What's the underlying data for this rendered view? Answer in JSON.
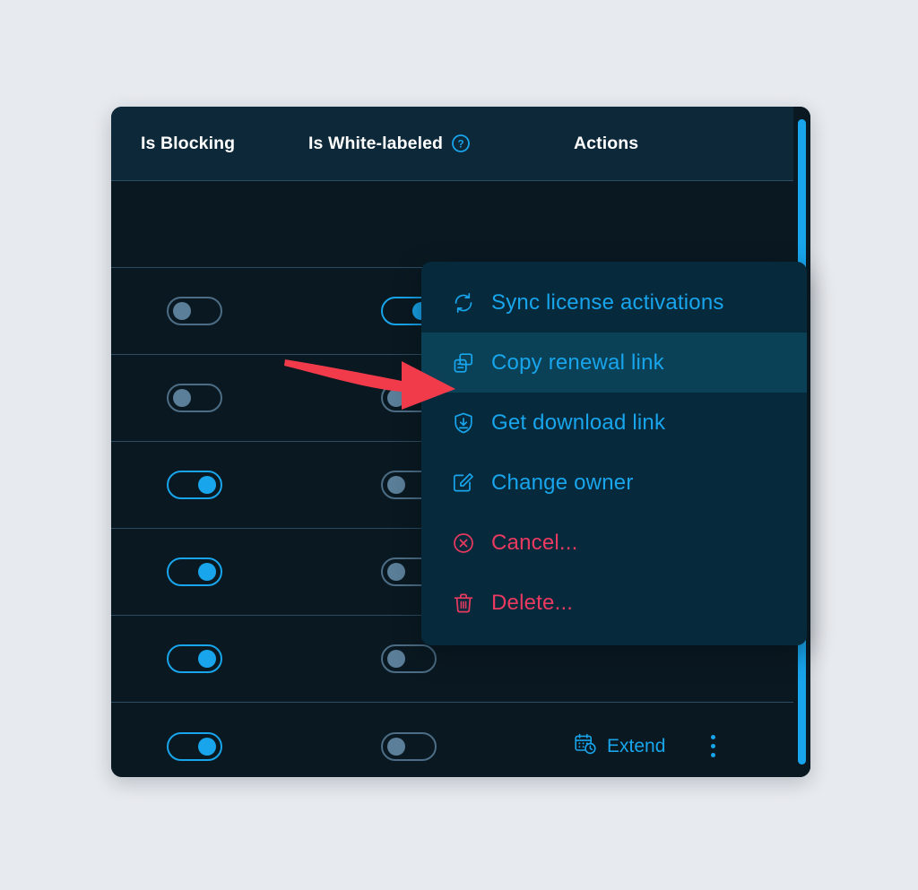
{
  "page": {
    "background_color": "#e7eaee"
  },
  "table": {
    "accent_color": "#18a5ec",
    "danger_color": "#ea3a60",
    "card_background": "#0a1921",
    "header_background": "#0d2838",
    "columns": [
      {
        "key": "is_blocking",
        "label": "Is Blocking",
        "has_help": false
      },
      {
        "key": "is_white_labeled",
        "label": "Is White-labeled",
        "has_help": true,
        "help_glyph": "?"
      },
      {
        "key": "actions",
        "label": "Actions",
        "has_help": false
      }
    ],
    "rows": [
      {
        "is_blocking": "off",
        "is_white_labeled": "on",
        "actions": []
      },
      {
        "is_blocking": "off",
        "is_white_labeled": "off",
        "actions": []
      },
      {
        "is_blocking": "on",
        "is_white_labeled": "off",
        "actions": []
      },
      {
        "is_blocking": "on",
        "is_white_labeled": "off",
        "actions": []
      },
      {
        "is_blocking": "on",
        "is_white_labeled": "off",
        "actions": []
      },
      {
        "is_blocking": "on",
        "is_white_labeled": "off",
        "actions": [
          "extend",
          "more"
        ]
      }
    ],
    "actions": {
      "extend_label": "Extend",
      "extend_icon": "calendar-clock-icon",
      "more_icon": "kebab-menu-icon"
    },
    "scrollbar": {
      "orientation": "vertical",
      "thumb_color": "#18a5ec"
    }
  },
  "context_menu": {
    "items": [
      {
        "icon": "sync-icon",
        "label": "Sync license activations",
        "tone": "normal",
        "highlighted": false
      },
      {
        "icon": "copy-icon",
        "label": "Copy renewal link",
        "tone": "normal",
        "highlighted": true
      },
      {
        "icon": "shield-download-icon",
        "label": "Get download link",
        "tone": "normal",
        "highlighted": false
      },
      {
        "icon": "edit-icon",
        "label": "Change owner",
        "tone": "normal",
        "highlighted": false
      },
      {
        "icon": "circle-x-icon",
        "label": "Cancel...",
        "tone": "danger",
        "highlighted": false
      },
      {
        "icon": "trash-icon",
        "label": "Delete...",
        "tone": "danger",
        "highlighted": false
      }
    ]
  },
  "annotation": {
    "type": "arrow",
    "color": "#f23b4a",
    "direction": "right",
    "points_at": "Copy renewal link"
  }
}
